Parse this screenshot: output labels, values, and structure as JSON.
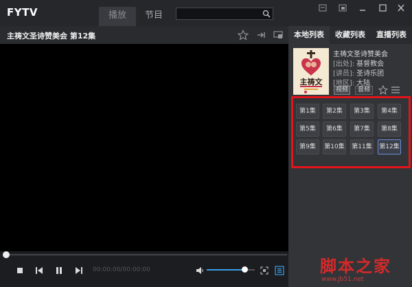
{
  "app": {
    "logo": "FYTV"
  },
  "main_tabs": [
    {
      "label": "播放",
      "active": true
    },
    {
      "label": "节目",
      "active": false
    }
  ],
  "search": {
    "value": "",
    "placeholder": ""
  },
  "video": {
    "title": "主祷文圣诗赞美会 第12集"
  },
  "controls": {
    "time": "00:00:00/00:00:00",
    "progress": 0,
    "volume": 0.78
  },
  "sidebar": {
    "tabs": [
      {
        "label": "本地列表",
        "active": true
      },
      {
        "label": "收藏列表",
        "active": false
      },
      {
        "label": "直播列表",
        "active": false
      }
    ],
    "detail": {
      "title": "主祷文圣诗赞美会",
      "rows": [
        {
          "label": "[出处]:",
          "value": "基督教会"
        },
        {
          "label": "[讲员]:",
          "value": "圣诗乐团"
        },
        {
          "label": "[地区]:",
          "value": "大陆"
        }
      ],
      "poster_text": "主祷文",
      "types": [
        {
          "label": "视频",
          "active": true
        },
        {
          "label": "音频",
          "active": false
        }
      ]
    },
    "episodes": [
      {
        "label": "第1集"
      },
      {
        "label": "第2集"
      },
      {
        "label": "第3集"
      },
      {
        "label": "第4集"
      },
      {
        "label": "第5集"
      },
      {
        "label": "第6集"
      },
      {
        "label": "第7集"
      },
      {
        "label": "第8集"
      },
      {
        "label": "第9集"
      },
      {
        "label": "第10集"
      },
      {
        "label": "第11集"
      },
      {
        "label": "第12集"
      }
    ],
    "selected_episode": 12
  },
  "watermark": {
    "main": "脚本之家",
    "sub": "www.jb51.net"
  },
  "colors": {
    "accent": "#3aa0e8",
    "highlight": "#e3141a",
    "selected": "#6a8ed8"
  }
}
